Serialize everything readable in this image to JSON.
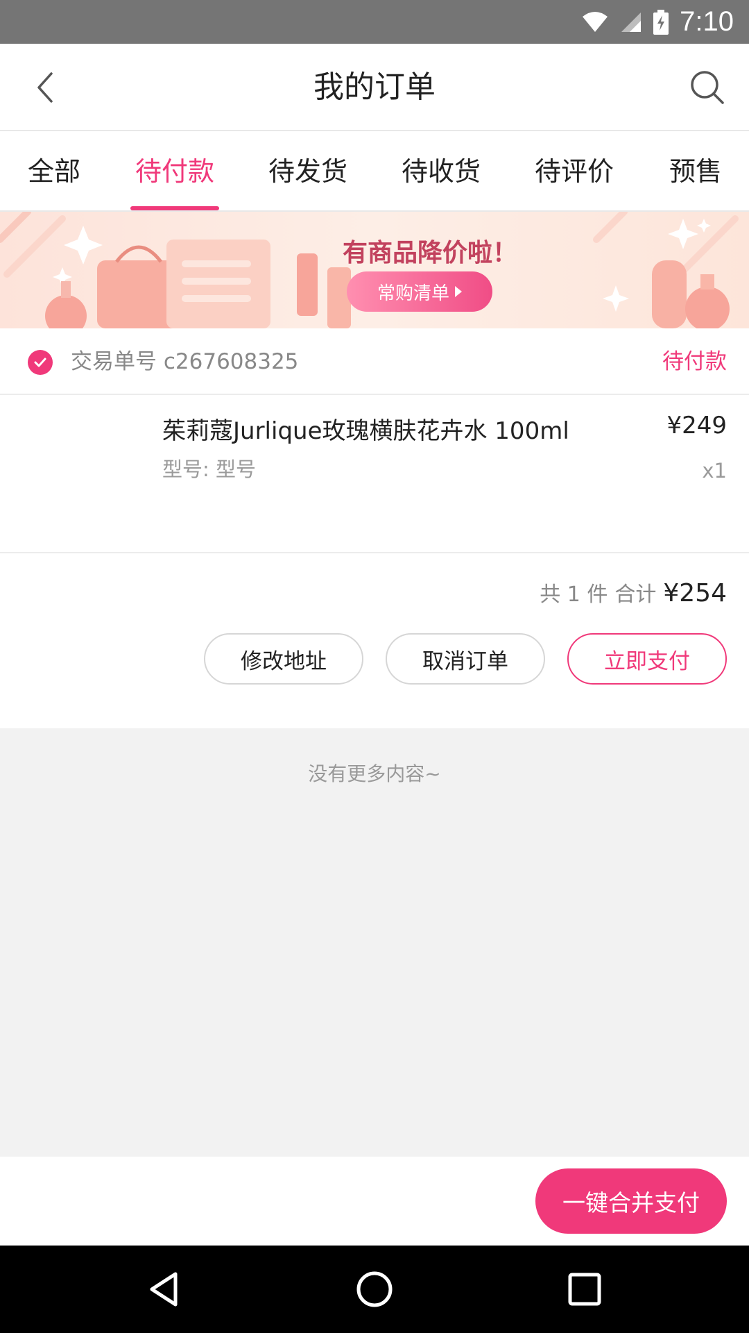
{
  "status_bar": {
    "time": "7:10",
    "icons": [
      "wifi-icon",
      "signal-icon",
      "battery-charging-icon"
    ]
  },
  "header": {
    "title": "我的订单",
    "back_icon": "chevron-left-icon",
    "search_icon": "search-icon"
  },
  "tabs": [
    {
      "label": "全部",
      "active": false
    },
    {
      "label": "待付款",
      "active": true
    },
    {
      "label": "待发货",
      "active": false
    },
    {
      "label": "待收货",
      "active": false
    },
    {
      "label": "待评价",
      "active": false
    },
    {
      "label": "预售",
      "active": false
    }
  ],
  "banner": {
    "title": "有商品降价啦！",
    "button_label": "常购清单"
  },
  "order": {
    "number_label": "交易单号 c267608325",
    "status": "待付款",
    "item": {
      "name": "茱莉蔻Jurlique玫瑰横肤花卉水 100ml",
      "price": "¥249",
      "spec": "型号: 型号",
      "qty": "x1"
    },
    "summary": {
      "count_text": "共 1 件",
      "total_label": "合计",
      "total_value": "¥254"
    },
    "actions": {
      "modify_address": "修改地址",
      "cancel_order": "取消订单",
      "pay_now": "立即支付"
    }
  },
  "empty_text": "没有更多内容~",
  "merge_pay_label": "一键合并支付",
  "colors": {
    "accent": "#f0397a",
    "status_bar": "#757575",
    "background_gray": "#f2f2f2"
  }
}
